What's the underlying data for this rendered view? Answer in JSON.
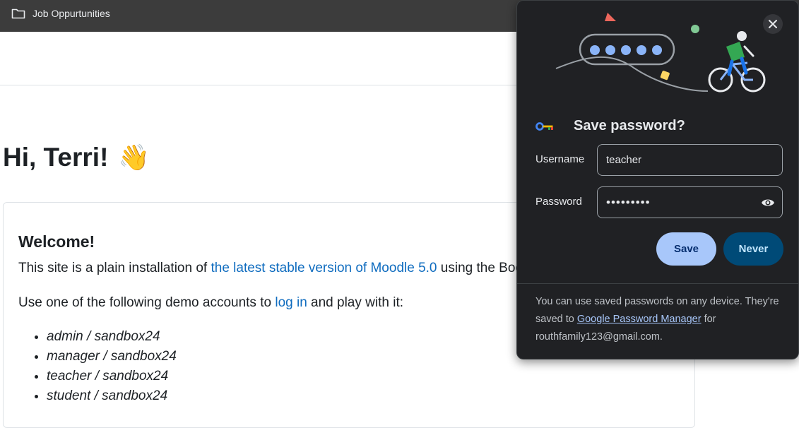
{
  "bookmarks": {
    "items": [
      {
        "label": "Job Oppurtunities",
        "icon": "folder-icon"
      }
    ]
  },
  "page": {
    "greeting": "Hi, Terri!",
    "greeting_emoji": "👋",
    "welcome_title": "Welcome!",
    "intro": {
      "before": "This site is a plain installation of ",
      "link": "the latest stable version of Moodle 5.0",
      "after": " using the Boost"
    },
    "demo": {
      "before": "Use one of the following demo accounts to ",
      "link": "log in",
      "after": " and play with it:"
    },
    "accounts": [
      "admin / sandbox24",
      "manager / sandbox24",
      "teacher / sandbox24",
      "student / sandbox24"
    ]
  },
  "password_popup": {
    "title": "Save password?",
    "username_label": "Username",
    "username_value": "teacher",
    "password_label": "Password",
    "password_value": "•••••••••",
    "save_label": "Save",
    "never_label": "Never",
    "footer": {
      "before": "You can use saved passwords on any device. They're saved to ",
      "link": "Google Password Manager",
      "after": " for routhfamily123@gmail.com."
    }
  },
  "colors": {
    "link": "#0f6cbf",
    "popup_bg": "#202124",
    "save_button": "#a8c7fa",
    "never_button": "#004a77"
  }
}
